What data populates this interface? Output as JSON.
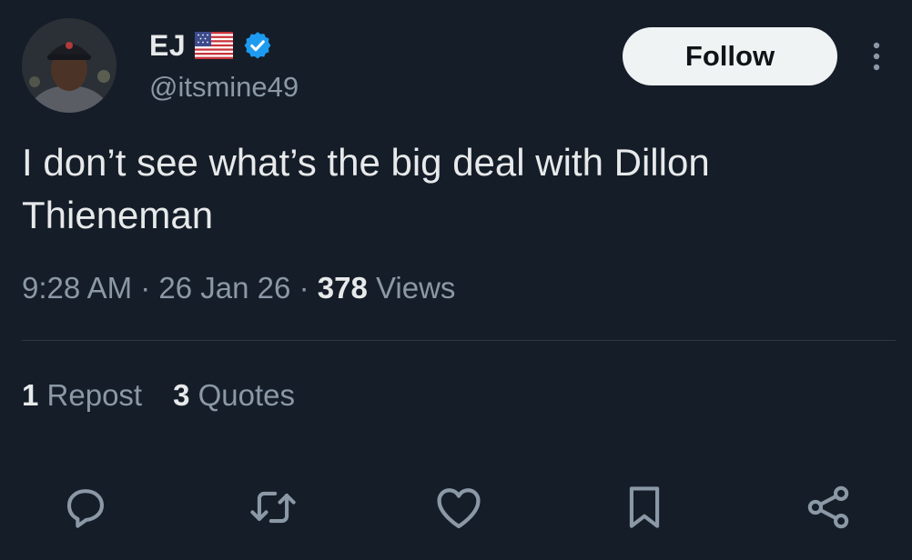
{
  "author": {
    "display_name": "EJ",
    "handle": "@itsmine49",
    "flag_icon": "us-flag-icon",
    "verified_icon": "verified-badge-icon",
    "verified_color": "#1d9bf0"
  },
  "header": {
    "follow_label": "Follow",
    "more_icon": "more-vertical-icon"
  },
  "tweet": {
    "text_line1": "I don’t see what’s the big deal with Dillon",
    "text_line2": "Thieneman"
  },
  "meta": {
    "time": "9:28 AM",
    "separator": "·",
    "date": "26 Jan 26",
    "views_count": "378",
    "views_label": "Views"
  },
  "stats": {
    "reposts_count": "1",
    "reposts_label": "Repost",
    "quotes_count": "3",
    "quotes_label": "Quotes"
  },
  "actions": [
    {
      "icon": "reply-icon"
    },
    {
      "icon": "retweet-icon"
    },
    {
      "icon": "like-icon"
    },
    {
      "icon": "bookmark-icon"
    },
    {
      "icon": "share-icon"
    }
  ],
  "colors": {
    "background": "#151d28",
    "primary_text": "#e7e9ea",
    "secondary_text": "#8b98a5",
    "follow_bg": "#eff3f4"
  }
}
